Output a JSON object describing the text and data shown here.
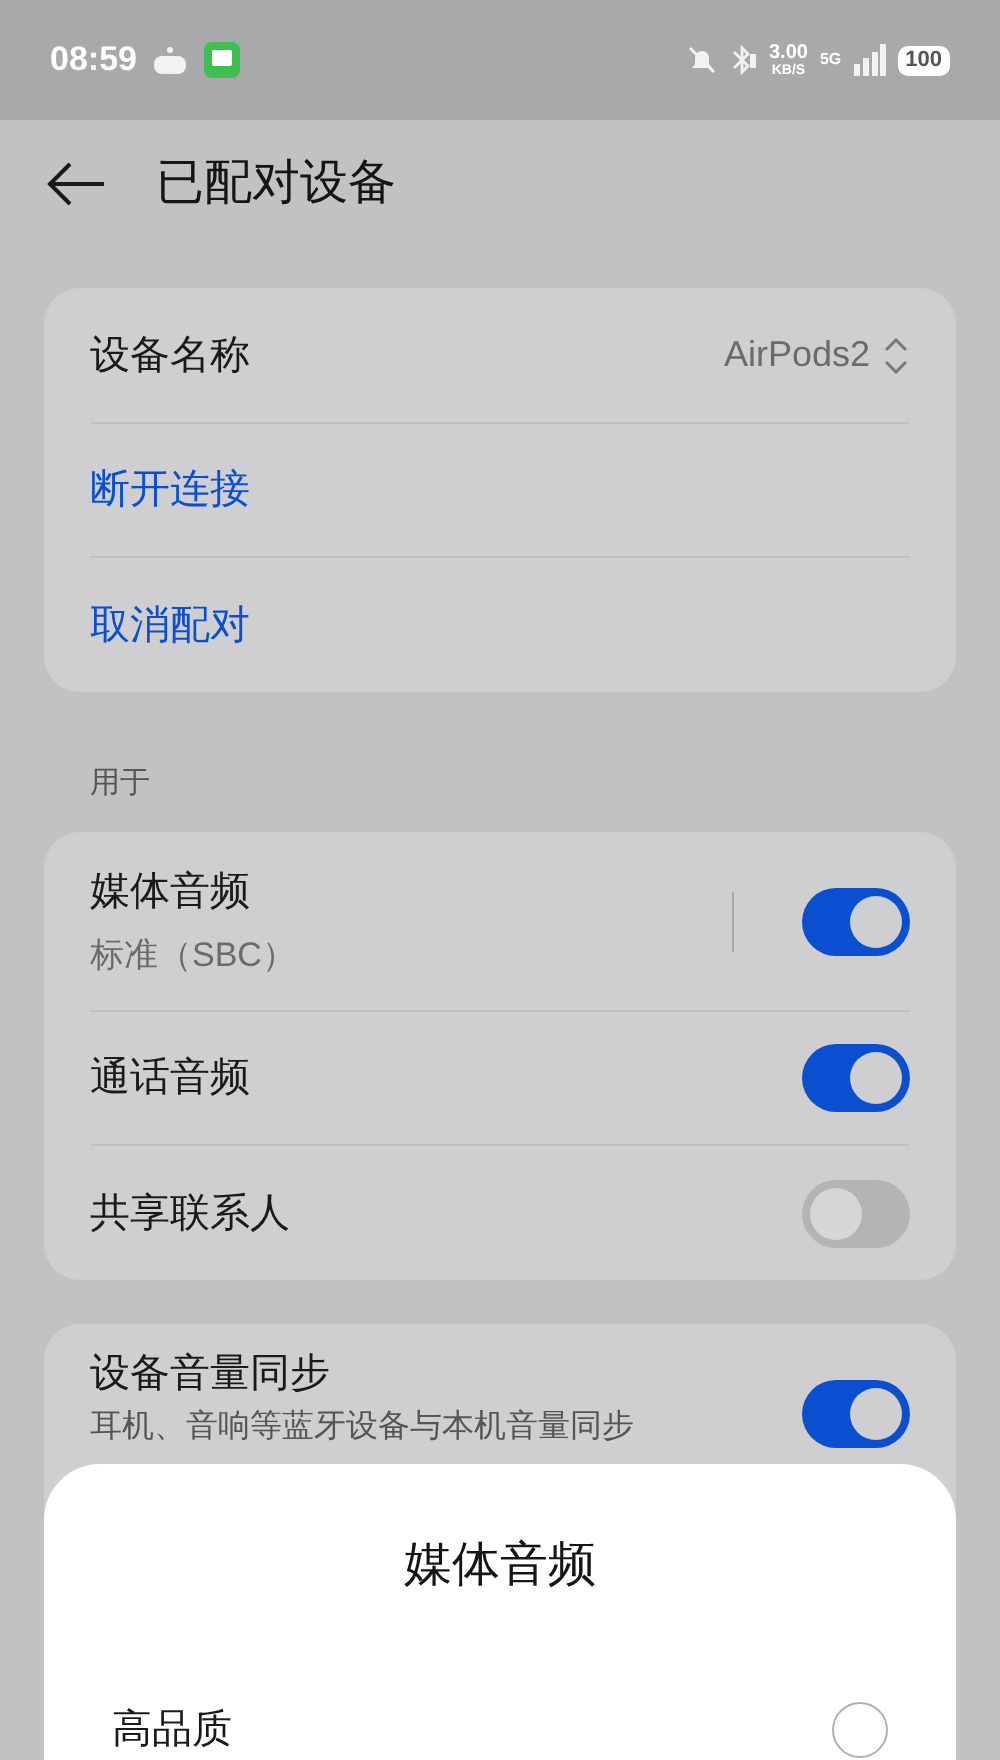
{
  "status_bar": {
    "time": "08:59",
    "speed": "3.00",
    "speed_unit": "KB/S",
    "network": "5G",
    "battery": "100"
  },
  "header": {
    "title": "已配对设备"
  },
  "device_card": {
    "name_label": "设备名称",
    "name_value": "AirPods2",
    "actions": [
      "断开连接",
      "取消配对"
    ]
  },
  "section_label": "用于",
  "usage": [
    {
      "title": "媒体音频",
      "subtitle": "标准（SBC）",
      "on": true,
      "divider": true
    },
    {
      "title": "通话音频",
      "on": true,
      "divider": false
    },
    {
      "title": "共享联系人",
      "on": false,
      "divider": false
    }
  ],
  "volume_sync": {
    "title": "设备音量同步",
    "subtitle": "耳机、音响等蓝牙设备与本机音量同步",
    "on": true
  },
  "sheet": {
    "title": "媒体音频",
    "options": [
      {
        "label": "高品质",
        "selected": false
      }
    ]
  }
}
